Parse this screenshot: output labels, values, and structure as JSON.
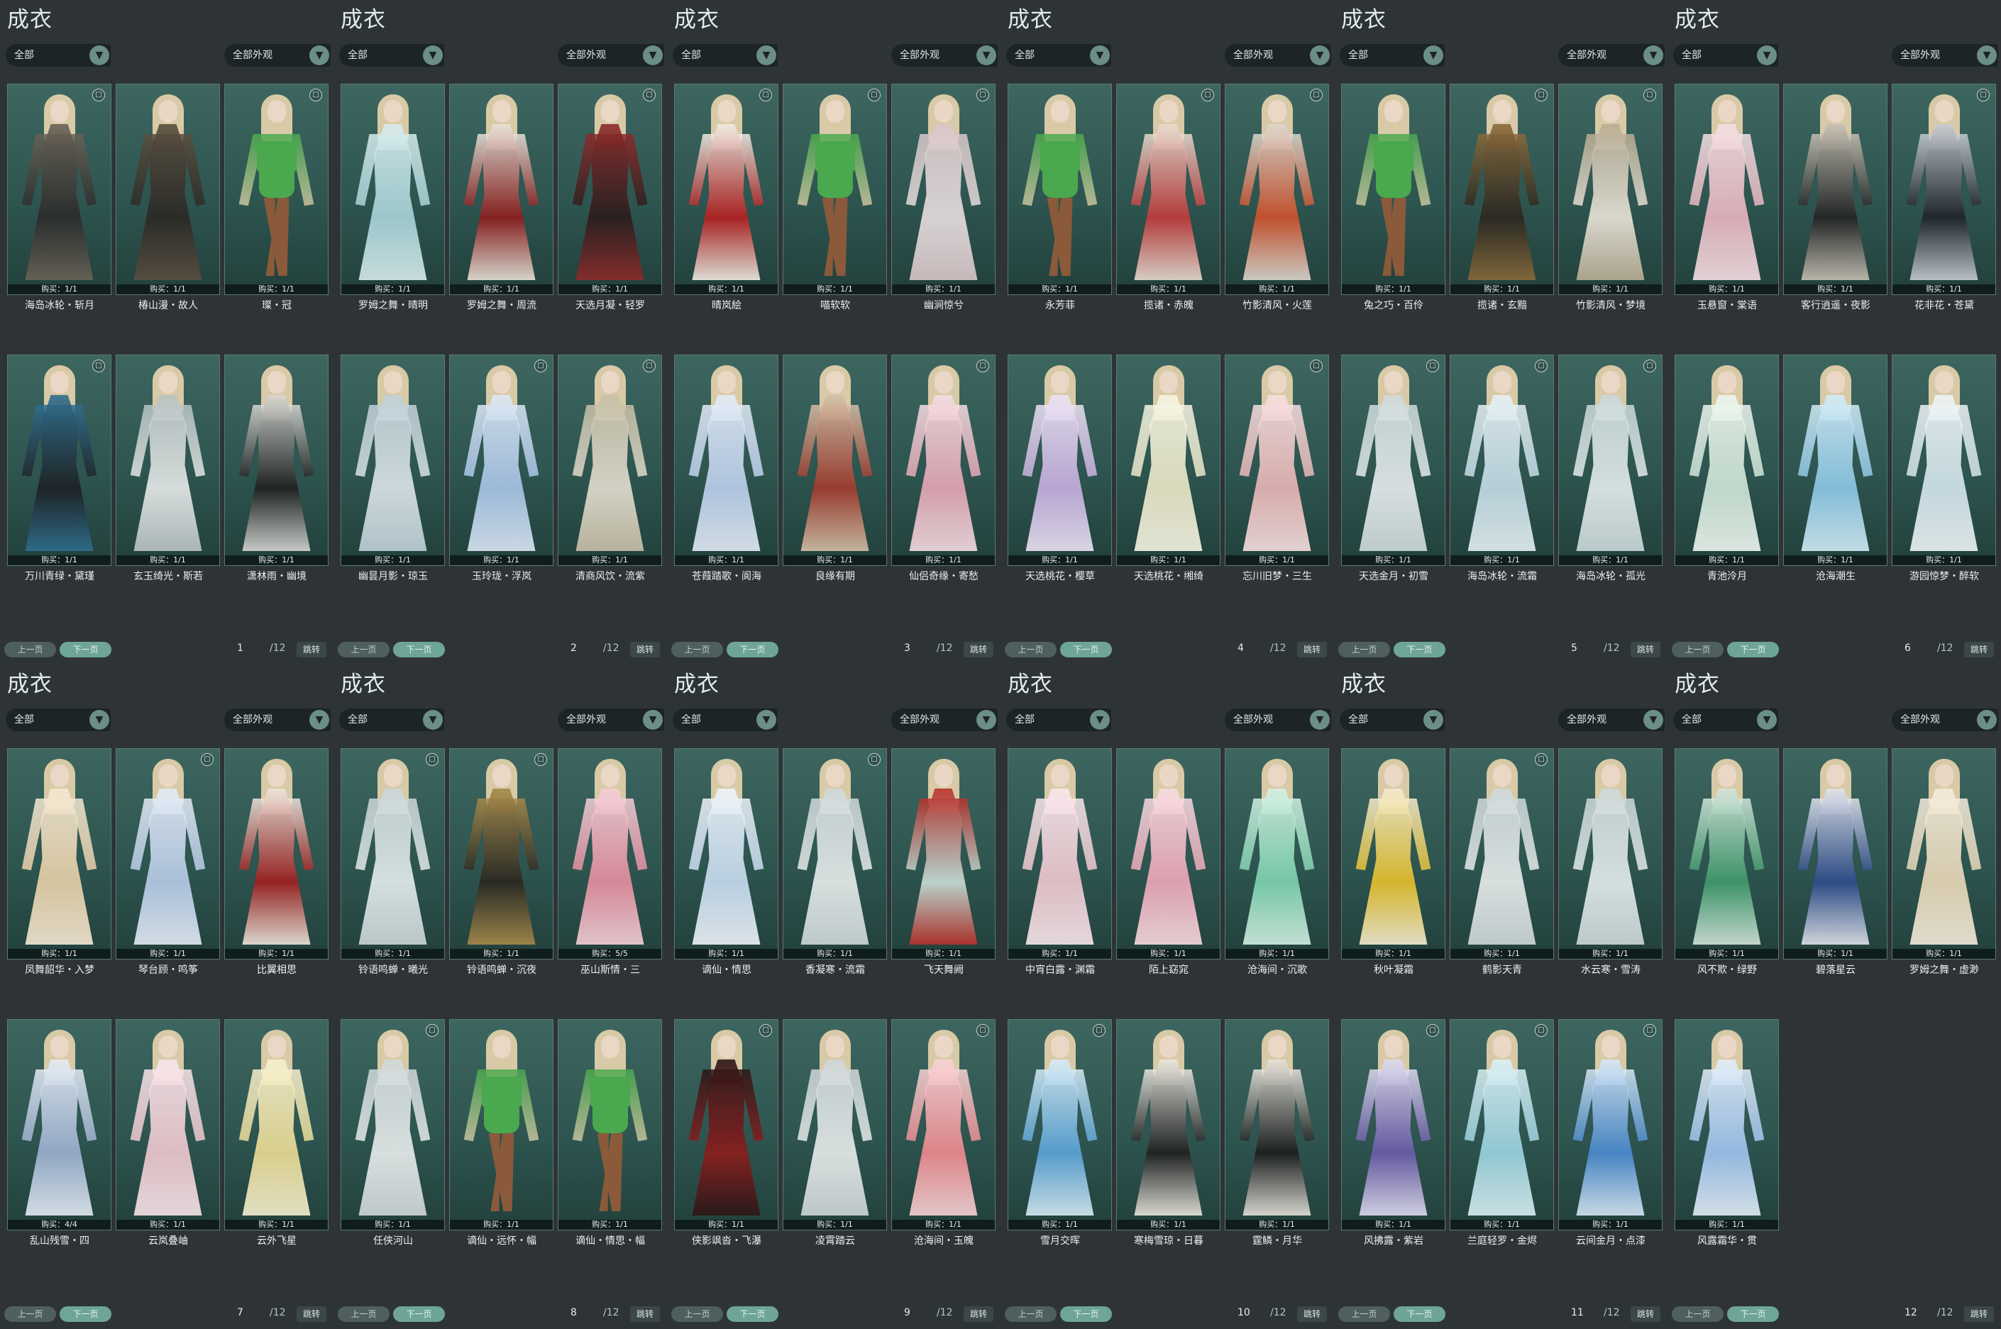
{
  "panel_title": "成衣",
  "filter_label": "全部",
  "filter2_label": "全部外观",
  "dropdown_arrow_icon": "chevron-down-icon",
  "prev_label": "上一页",
  "next_label": "下一页",
  "jump_label": "跳转",
  "total_pages": "/12",
  "colors": {
    "bg": "#2e3435",
    "card": "#2e5550",
    "accent": "#6ea596"
  },
  "panels": [
    {
      "page": "1",
      "items": [
        {
          "name": "海岛冰轮・斩月",
          "buy": "购买：1/1",
          "badge": "bin-icon",
          "tone": "#2a2a2a",
          "tone2": "#6a6256",
          "style": "gown"
        },
        {
          "name": "椿山漫・故人",
          "buy": "购买：1/1",
          "badge": "",
          "tone": "#2b2723",
          "tone2": "#5a4e40",
          "style": "gown"
        },
        {
          "name": "璨・冠",
          "buy": "购买：1/1",
          "badge": "bin-icon",
          "tone": "#d9c9a8",
          "tone2": "#4aa84e",
          "style": "shorts"
        },
        {
          "name": "万川青绿・黛瑾",
          "buy": "购买：1/1",
          "badge": "bin-icon",
          "tone": "#1d1f22",
          "tone2": "#2f6e8f",
          "style": "gown"
        },
        {
          "name": "玄玉绮光・斯若",
          "buy": "购买：1/1",
          "badge": "",
          "tone": "#e8eceb",
          "tone2": "#b8c2c2",
          "style": "gown"
        },
        {
          "name": "潇林雨・幽境",
          "buy": "购买：1/1",
          "badge": "",
          "tone": "#1e1e1e",
          "tone2": "#d8d8d4",
          "style": "gown"
        }
      ]
    },
    {
      "page": "2",
      "items": [
        {
          "name": "罗姆之舞・晴明",
          "buy": "购买：1/1",
          "badge": "",
          "tone": "#a8d4d8",
          "tone2": "#d8ecee",
          "style": "gown"
        },
        {
          "name": "罗姆之舞・周流",
          "buy": "购买：1/1",
          "badge": "",
          "tone": "#8e1c1c",
          "tone2": "#e8e2d8",
          "style": "gown"
        },
        {
          "name": "天选月凝・轻罗",
          "buy": "购买：1/1",
          "badge": "bin-icon",
          "tone": "#2a1b1b",
          "tone2": "#8e2a2a",
          "style": "gown"
        },
        {
          "name": "幽昙月影・琼玉",
          "buy": "购买：1/1",
          "badge": "",
          "tone": "#dde6ea",
          "tone2": "#bfd0d8",
          "style": "gown"
        },
        {
          "name": "玉玲珑・浮岚",
          "buy": "购买：1/1",
          "badge": "bin-icon",
          "tone": "#a8c4e8",
          "tone2": "#dce8f4",
          "style": "gown"
        },
        {
          "name": "清商风饮・流紫",
          "buy": "购买：1/1",
          "badge": "bin-icon",
          "tone": "#e4dfd0",
          "tone2": "#c8bfa8",
          "style": "gown"
        }
      ]
    },
    {
      "page": "3",
      "items": [
        {
          "name": "晴岚絵",
          "buy": "购买：1/1",
          "badge": "bin-icon",
          "tone": "#b41e1e",
          "tone2": "#f0ece4",
          "style": "gown"
        },
        {
          "name": "喵软软",
          "buy": "购买：1/1",
          "badge": "bin-icon",
          "tone": "#d9c9a8",
          "tone2": "#4aa84e",
          "style": "shorts"
        },
        {
          "name": "幽涧惊兮",
          "buy": "购买：1/1",
          "badge": "bin-icon",
          "tone": "#e9dfe0",
          "tone2": "#d8c6c8",
          "style": "gown"
        },
        {
          "name": "苍葭踏歌・阆海",
          "buy": "购买：1/1",
          "badge": "",
          "tone": "#bcd0ee",
          "tone2": "#e4ecf6",
          "style": "gown"
        },
        {
          "name": "良缘有期",
          "buy": "购买：1/1",
          "badge": "",
          "tone": "#a23a2c",
          "tone2": "#d4c0a8",
          "style": "gown"
        },
        {
          "name": "仙侣奇缘・寄愁",
          "buy": "购买：1/1",
          "badge": "bin-icon",
          "tone": "#e6a6b4",
          "tone2": "#f4dde2",
          "style": "gown"
        }
      ]
    },
    {
      "page": "4",
      "items": [
        {
          "name": "永芳菲",
          "buy": "购买：1/1",
          "badge": "",
          "tone": "#d9c9a8",
          "tone2": "#4aa84e",
          "style": "shorts"
        },
        {
          "name": "揽诸・赤魄",
          "buy": "购买：1/1",
          "badge": "bin-icon",
          "tone": "#c23a3a",
          "tone2": "#e8dcd0",
          "style": "gown"
        },
        {
          "name": "竹影清风・火莲",
          "buy": "购买：1/1",
          "badge": "bin-icon",
          "tone": "#d0502a",
          "tone2": "#dcd8d0",
          "style": "gown"
        },
        {
          "name": "天选桃花・樱草",
          "buy": "购买：1/1",
          "badge": "",
          "tone": "#c8aee0",
          "tone2": "#ece4f4",
          "style": "gown"
        },
        {
          "name": "天选桃花・缃绮",
          "buy": "购买：1/1",
          "badge": "",
          "tone": "#ece8c8",
          "tone2": "#f6f4e4",
          "style": "gown"
        },
        {
          "name": "忘川旧梦・三生",
          "buy": "购买：1/1",
          "badge": "bin-icon",
          "tone": "#eab6b6",
          "tone2": "#f6e0e0",
          "style": "gown"
        }
      ]
    },
    {
      "page": "5",
      "items": [
        {
          "name": "兔之巧・百伶",
          "buy": "购买：1/1",
          "badge": "",
          "tone": "#d9c9a8",
          "tone2": "#4aa84e",
          "style": "shorts"
        },
        {
          "name": "揽诸・玄黯",
          "buy": "购买：1/1",
          "badge": "bin-icon",
          "tone": "#2a2520",
          "tone2": "#8a6a3a",
          "style": "gown"
        },
        {
          "name": "竹影清风・梦境",
          "buy": "购买：1/1",
          "badge": "bin-icon",
          "tone": "#ece6da",
          "tone2": "#b8ac94",
          "style": "gown"
        },
        {
          "name": "天选金月・初雪",
          "buy": "购买：1/1",
          "badge": "bin-icon",
          "tone": "#e8eeee",
          "tone2": "#cfdadb",
          "style": "gown"
        },
        {
          "name": "海岛冰轮・流霜",
          "buy": "购买：1/1",
          "badge": "bin-icon",
          "tone": "#c4dce6",
          "tone2": "#e6f0f4",
          "style": "gown"
        },
        {
          "name": "海岛冰轮・孤光",
          "buy": "购买：1/1",
          "badge": "bin-icon",
          "tone": "#e6eeee",
          "tone2": "#cad8da",
          "style": "gown"
        }
      ]
    },
    {
      "page": "6",
      "items": [
        {
          "name": "玉悬窗・棠语",
          "buy": "购买：1/1",
          "badge": "",
          "tone": "#eab6c0",
          "tone2": "#f4e0e4",
          "style": "gown"
        },
        {
          "name": "客行逍遥・夜影",
          "buy": "购买：1/1",
          "badge": "",
          "tone": "#222",
          "tone2": "#c8c0b4",
          "style": "gown"
        },
        {
          "name": "花非花・苍黛",
          "buy": "购买：1/1",
          "badge": "bin-icon",
          "tone": "#1e2228",
          "tone2": "#c8ccd4",
          "style": "gown"
        },
        {
          "name": "青池泠月",
          "buy": "购买：1/1",
          "badge": "",
          "tone": "#cfe6d8",
          "tone2": "#eef6f0",
          "style": "gown"
        },
        {
          "name": "沧海潮生",
          "buy": "购买：1/1",
          "badge": "",
          "tone": "#8cc8e8",
          "tone2": "#d4ecf6",
          "style": "gown"
        },
        {
          "name": "游园惊梦・醉软",
          "buy": "购买：1/1",
          "badge": "",
          "tone": "#d4e6ee",
          "tone2": "#eef4f6",
          "style": "gown"
        }
      ]
    },
    {
      "page": "7",
      "items": [
        {
          "name": "凤舞韶华・入梦",
          "buy": "购买：1/1",
          "badge": "",
          "tone": "#e8d0a8",
          "tone2": "#f4e8d4",
          "style": "gown"
        },
        {
          "name": "琴台顾・鸣筝",
          "buy": "购买：1/1",
          "badge": "bin-icon",
          "tone": "#b8cce8",
          "tone2": "#e4ecf6",
          "style": "gown"
        },
        {
          "name": "比翼相思",
          "buy": "购买：1/1",
          "badge": "",
          "tone": "#a01e1e",
          "tone2": "#eee6dc",
          "style": "gown"
        },
        {
          "name": "乱山残雪・四",
          "buy": "购买：4/4",
          "badge": "",
          "tone": "#9cb0d0",
          "tone2": "#e4ecf4",
          "style": "gown"
        },
        {
          "name": "云岚叠岫",
          "buy": "购买：1/1",
          "badge": "",
          "tone": "#f0c8d0",
          "tone2": "#f8e6ea",
          "style": "gown"
        },
        {
          "name": "云外飞星",
          "buy": "购买：1/1",
          "badge": "",
          "tone": "#ecdc94",
          "tone2": "#f6f0d0",
          "style": "gown"
        }
      ]
    },
    {
      "page": "8",
      "items": [
        {
          "name": "铃语鸣蝉・曦光",
          "buy": "购买：1/1",
          "badge": "bin-icon",
          "tone": "#e6eeee",
          "tone2": "#cad6d8",
          "style": "gown"
        },
        {
          "name": "铃语鸣蝉・沉夜",
          "buy": "购买：1/1",
          "badge": "bin-icon",
          "tone": "#2a2620",
          "tone2": "#a88a4a",
          "style": "gown"
        },
        {
          "name": "巫山斯情・三",
          "buy": "购买：5/5",
          "badge": "",
          "tone": "#e88ea0",
          "tone2": "#f4d0d8",
          "style": "gown"
        },
        {
          "name": "任侠河山",
          "buy": "购买：1/1",
          "badge": "bin-icon",
          "tone": "#eaeeee",
          "tone2": "#d0d8da",
          "style": "gown"
        },
        {
          "name": "谪仙・远怀・幅",
          "buy": "购买：1/1",
          "badge": "",
          "tone": "#d9c9a8",
          "tone2": "#4aa84e",
          "style": "shorts"
        },
        {
          "name": "谪仙・情思・幅",
          "buy": "购买：1/1",
          "badge": "",
          "tone": "#d9c9a8",
          "tone2": "#4aa84e",
          "style": "shorts"
        }
      ]
    },
    {
      "page": "9",
      "items": [
        {
          "name": "谪仙・情思",
          "buy": "购买：1/1",
          "badge": "",
          "tone": "#c8dcf0",
          "tone2": "#eef4fa",
          "style": "gown"
        },
        {
          "name": "香凝寒・流霜",
          "buy": "购买：1/1",
          "badge": "bin-icon",
          "tone": "#eaeeee",
          "tone2": "#cfd8da",
          "style": "gown"
        },
        {
          "name": "飞天舞阙",
          "buy": "购买：1/1",
          "badge": "",
          "tone": "#c8e0d8",
          "tone2": "#b8302a",
          "style": "gown"
        },
        {
          "name": "侠影飒沓・飞瀑",
          "buy": "购买：1/1",
          "badge": "bin-icon",
          "tone": "#8e1c1c",
          "tone2": "#2a1616",
          "style": "gown"
        },
        {
          "name": "凌霄踏云",
          "buy": "购买：1/1",
          "badge": "",
          "tone": "#eaeeee",
          "tone2": "#cfd6d8",
          "style": "gown"
        },
        {
          "name": "沧海间・玉魄",
          "buy": "购买：1/1",
          "badge": "bin-icon",
          "tone": "#f08a90",
          "tone2": "#f8d4d6",
          "style": "gown"
        }
      ]
    },
    {
      "page": "10",
      "items": [
        {
          "name": "中宵白露・渊霜",
          "buy": "购买：1/1",
          "badge": "",
          "tone": "#f0c8d0",
          "tone2": "#f8e8ec",
          "style": "gown"
        },
        {
          "name": "陌上窈窕",
          "buy": "购买：1/1",
          "badge": "",
          "tone": "#f0a8b8",
          "tone2": "#f8dce2",
          "style": "gown"
        },
        {
          "name": "沧海间・沉歌",
          "buy": "购买：1/1",
          "badge": "",
          "tone": "#7ed4b0",
          "tone2": "#d4f0e4",
          "style": "gown"
        },
        {
          "name": "雪月交晖",
          "buy": "购买：1/1",
          "badge": "bin-icon",
          "tone": "#5aa4d8",
          "tone2": "#d8ecf6",
          "style": "gown"
        },
        {
          "name": "寒梅雪琼・日暮",
          "buy": "购买：1/1",
          "badge": "",
          "tone": "#1e1e1e",
          "tone2": "#ece8e0",
          "style": "gown"
        },
        {
          "name": "霆鳞・月华",
          "buy": "购买：1/1",
          "badge": "",
          "tone": "#1a1a1a",
          "tone2": "#e8e4dc",
          "style": "gown"
        }
      ]
    },
    {
      "page": "11",
      "items": [
        {
          "name": "秋叶凝霜",
          "buy": "购买：1/1",
          "badge": "",
          "tone": "#e8c02a",
          "tone2": "#f4ecd0",
          "style": "gown"
        },
        {
          "name": "鹤影天青",
          "buy": "购买：1/1",
          "badge": "bin-icon",
          "tone": "#eaeeee",
          "tone2": "#cfd8da",
          "style": "gown"
        },
        {
          "name": "水云寒・雪涛",
          "buy": "购买：1/1",
          "badge": "",
          "tone": "#e6eeee",
          "tone2": "#cdd8da",
          "style": "gown"
        },
        {
          "name": "风拂露・紫岩",
          "buy": "购买：1/1",
          "badge": "bin-icon",
          "tone": "#6a5aa8",
          "tone2": "#e0dcf0",
          "style": "gown"
        },
        {
          "name": "兰庭轻罗・金烬",
          "buy": "购买：1/1",
          "badge": "bin-icon",
          "tone": "#9cd4e0",
          "tone2": "#dcf0f4",
          "style": "gown"
        },
        {
          "name": "云间金月・点漆",
          "buy": "购买：1/1",
          "badge": "bin-icon",
          "tone": "#4a8ad0",
          "tone2": "#d8e8f6",
          "style": "gown"
        }
      ]
    },
    {
      "page": "12",
      "items": [
        {
          "name": "风不欺・绿野",
          "buy": "购买：1/1",
          "badge": "",
          "tone": "#3e9a6a",
          "tone2": "#d4e6dc",
          "style": "gown"
        },
        {
          "name": "碧落星云",
          "buy": "购买：1/1",
          "badge": "",
          "tone": "#2e4a8a",
          "tone2": "#e0e4ec",
          "style": "gown"
        },
        {
          "name": "罗姆之舞・虚渺",
          "buy": "购买：1/1",
          "badge": "",
          "tone": "#ead8b8",
          "tone2": "#f4ecdc",
          "style": "gown"
        },
        {
          "name": "风露霜华・贯",
          "buy": "购买：1/1",
          "badge": "",
          "tone": "#a0c4f0",
          "tone2": "#e4eef8",
          "style": "gown"
        }
      ]
    }
  ]
}
